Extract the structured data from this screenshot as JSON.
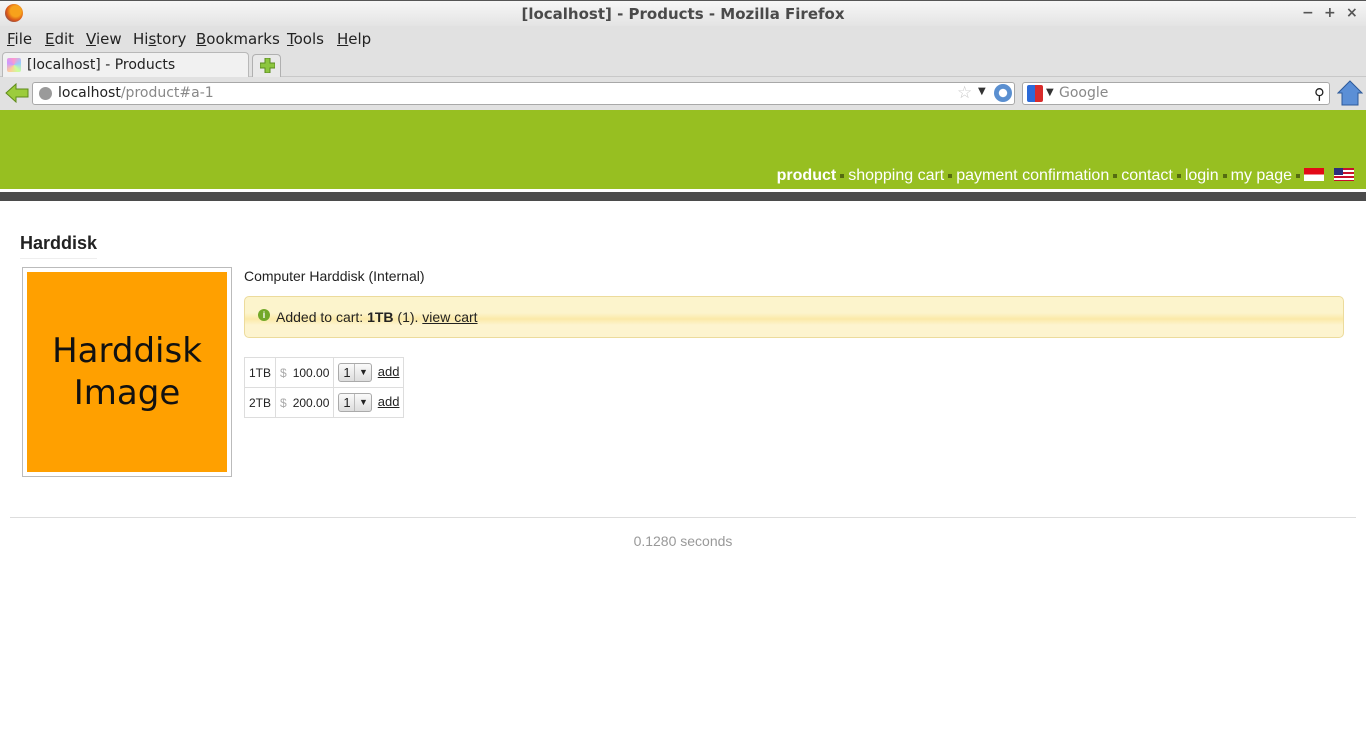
{
  "window": {
    "title": "[localhost] - Products - Mozilla Firefox",
    "controls": {
      "minimize": "−",
      "maximize": "+",
      "close": "×"
    }
  },
  "menubar": {
    "items": [
      {
        "label": "File",
        "accel": "F",
        "rest": "ile"
      },
      {
        "label": "Edit",
        "accel": "E",
        "rest": "dit"
      },
      {
        "label": "View",
        "accel": "V",
        "rest": "iew"
      },
      {
        "label": "History",
        "pre": "Hi",
        "accel": "s",
        "rest": "tory"
      },
      {
        "label": "Bookmarks",
        "accel": "B",
        "rest": "ookmarks"
      },
      {
        "label": "Tools",
        "accel": "T",
        "rest": "ools"
      },
      {
        "label": "Help",
        "accel": "H",
        "rest": "elp"
      }
    ]
  },
  "tabs": [
    {
      "label": "[localhost] - Products",
      "active": true
    }
  ],
  "navbar": {
    "url_host": "localhost",
    "url_path": "/product#a-1",
    "search_placeholder": "Google",
    "search_engine": "Google"
  },
  "site": {
    "nav": [
      {
        "label": "product",
        "active": true
      },
      {
        "label": "shopping cart"
      },
      {
        "label": "payment confirmation"
      },
      {
        "label": "contact"
      },
      {
        "label": "login"
      },
      {
        "label": "my page"
      }
    ],
    "languages": [
      {
        "name": "Indonesian",
        "icon": "flag-id-icon"
      },
      {
        "name": "English",
        "icon": "flag-us-icon"
      }
    ],
    "colors": {
      "header": "#97bf21",
      "bar": "#4b4b4b",
      "image_bg": "#ffa000"
    }
  },
  "product": {
    "title": "Harddisk",
    "image_text_line1": "Harddisk",
    "image_text_line2": "Image",
    "description": "Computer Harddisk (Internal)",
    "notice": {
      "prefix": "Added to cart: ",
      "item": "1TB",
      "qty": " (1). ",
      "link": "view cart"
    },
    "variants": [
      {
        "name": "1TB",
        "currency": "$",
        "price": "100.00",
        "qty": "1",
        "action": "add"
      },
      {
        "name": "2TB",
        "currency": "$",
        "price": "200.00",
        "qty": "1",
        "action": "add"
      }
    ]
  },
  "footer": {
    "time": "0.1280 seconds"
  }
}
